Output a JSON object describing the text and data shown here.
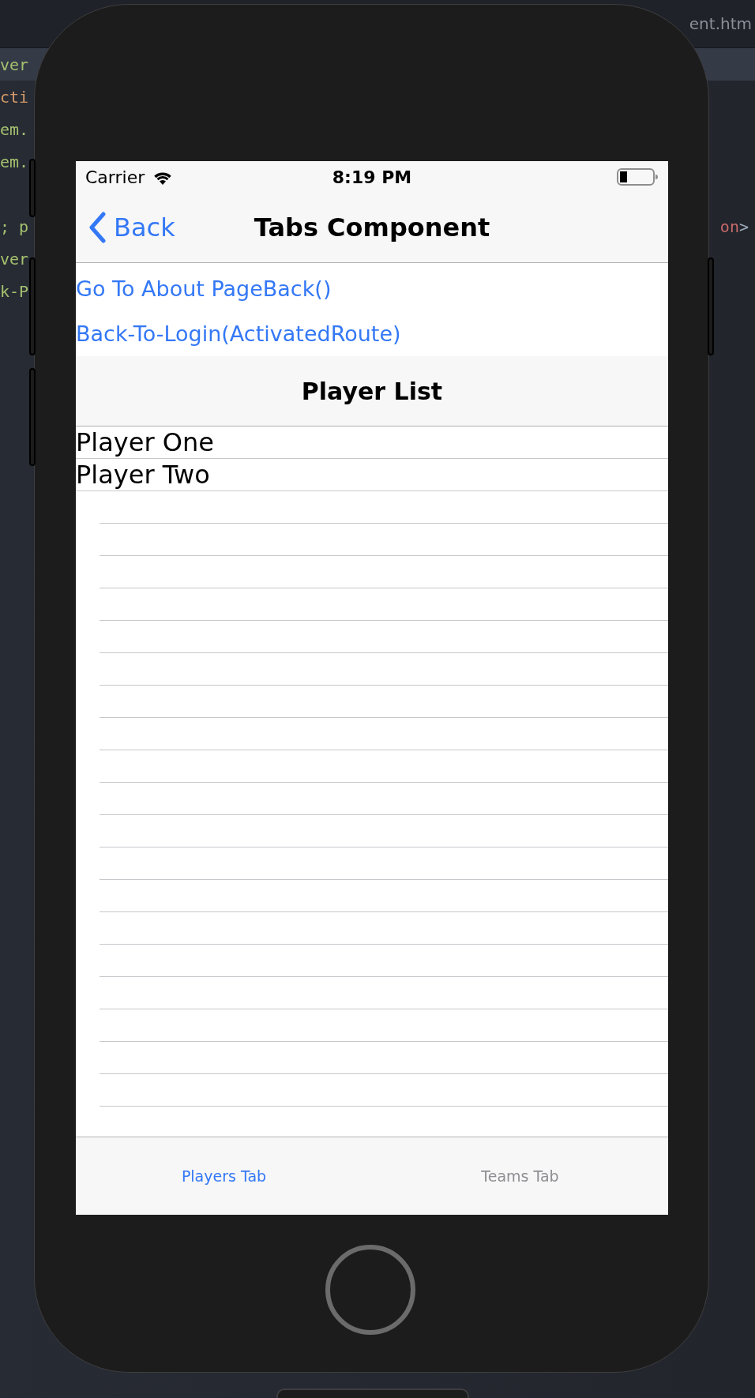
{
  "editor": {
    "tab_title": "ent.htm",
    "lines": [
      {
        "kind": "code",
        "current": true,
        "left": {
          "text": "ver",
          "color": "#a5c26f"
        }
      },
      {
        "kind": "code",
        "current": false,
        "left": {
          "text": "cti",
          "color": "#d49a6a"
        }
      },
      {
        "kind": "code",
        "current": false,
        "left": {
          "text": "em.",
          "color": "#a5c26f"
        }
      },
      {
        "kind": "code",
        "current": false,
        "left": {
          "text": "em.",
          "color": "#a5c26f"
        }
      },
      {
        "kind": "blank"
      },
      {
        "kind": "code",
        "current": false,
        "left": {
          "text": "; p",
          "color": "#a5c26f"
        },
        "right": [
          {
            "text": "on",
            "color": "#c8696a"
          },
          {
            "text": ">",
            "color": "#9ea9ba"
          }
        ]
      },
      {
        "kind": "code",
        "current": false,
        "left": {
          "text": "ver",
          "color": "#a5c26f"
        }
      },
      {
        "kind": "code",
        "current": false,
        "left": {
          "text": "k-P",
          "color": "#a5c26f"
        }
      }
    ]
  },
  "status_bar": {
    "carrier": "Carrier",
    "time": "8:19 PM"
  },
  "nav_bar": {
    "back": "Back",
    "title": "Tabs Component"
  },
  "links": [
    "Go To About PageBack()",
    "Back-To-Login(ActivatedRoute)"
  ],
  "list_header": "Player List",
  "players": [
    "Player One",
    "Player Two"
  ],
  "tab_bar": [
    {
      "label": "Players Tab",
      "selected": true
    },
    {
      "label": "Teams Tab",
      "selected": false
    }
  ]
}
